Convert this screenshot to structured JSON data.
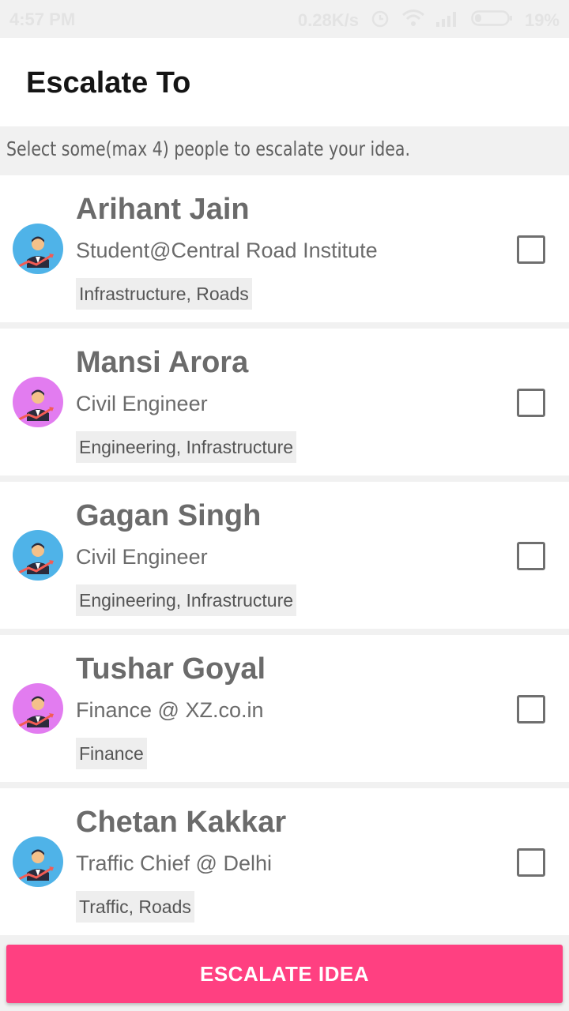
{
  "status_bar": {
    "time": "4:57 PM",
    "network_speed": "0.28K/s",
    "battery": "19%",
    "icons": [
      "alarm-icon",
      "wifi-icon",
      "signal-icon",
      "battery-icon"
    ]
  },
  "app_bar": {
    "title": "Escalate To"
  },
  "instruction": "Select some(max 4) people to escalate your idea.",
  "people": [
    {
      "name": "Arihant Jain",
      "role": "Student@Central Road Institute",
      "tags": "Infrastructure, Roads",
      "avatar_color": "#4fb3e8",
      "checked": false
    },
    {
      "name": "Mansi Arora",
      "role": "Civil Engineer",
      "tags": "Engineering, Infrastructure",
      "avatar_color": "#e27cf0",
      "checked": false
    },
    {
      "name": "Gagan Singh",
      "role": "Civil Engineer",
      "tags": "Engineering, Infrastructure",
      "avatar_color": "#4fb3e8",
      "checked": false
    },
    {
      "name": "Tushar Goyal",
      "role": "Finance @ XZ.co.in",
      "tags": "Finance",
      "avatar_color": "#e27cf0",
      "checked": false
    },
    {
      "name": "Chetan Kakkar",
      "role": "Traffic Chief @ Delhi",
      "tags": "Traffic, Roads",
      "avatar_color": "#4fb3e8",
      "checked": false
    }
  ],
  "primary_action": {
    "label": "ESCALATE IDEA"
  },
  "colors": {
    "accent": "#ff4081",
    "avatar_blue": "#4fb3e8",
    "avatar_pink": "#e27cf0"
  }
}
